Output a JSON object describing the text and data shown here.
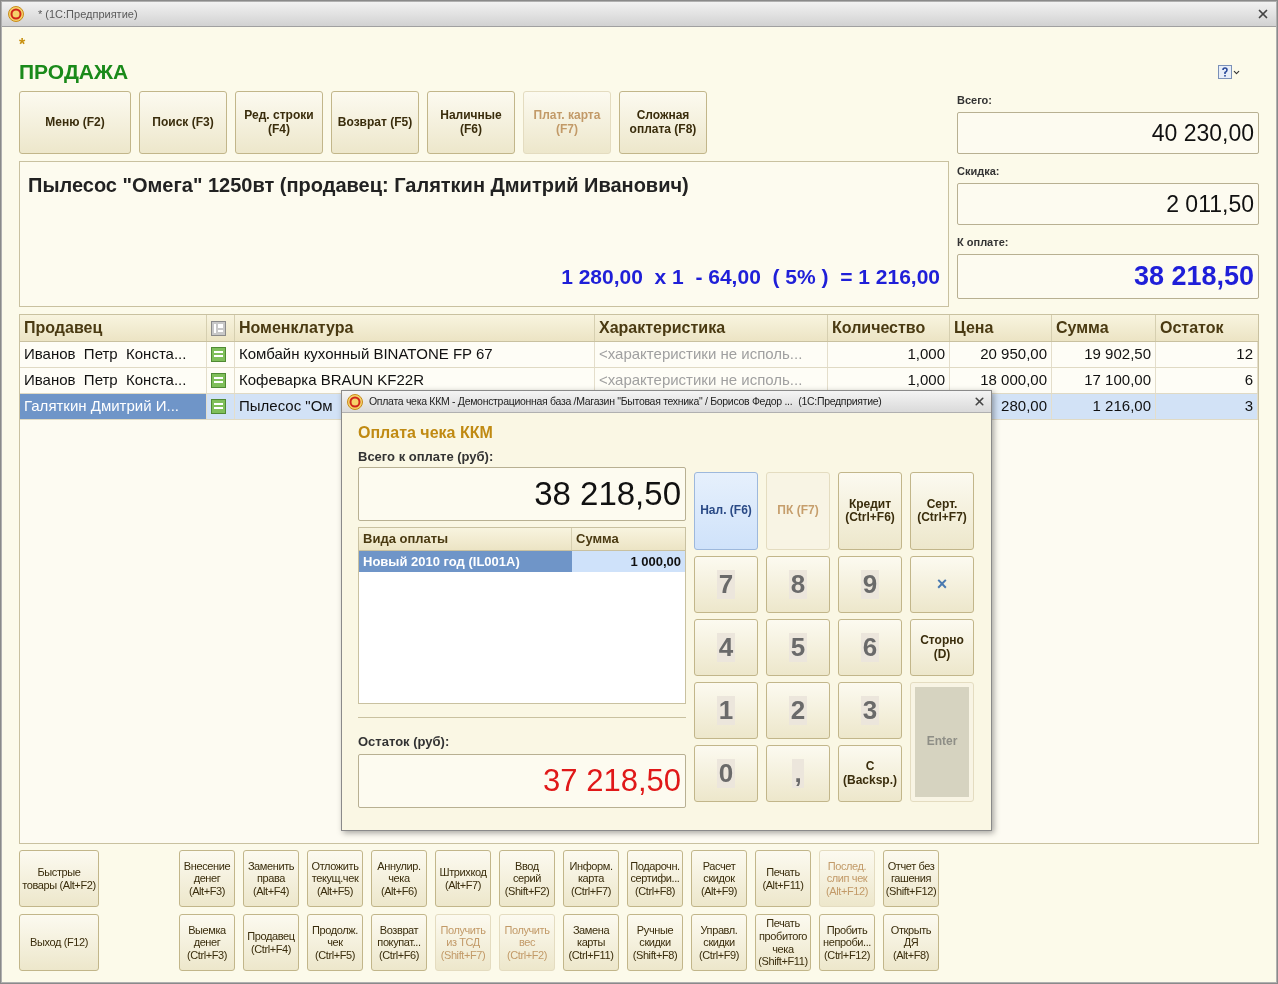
{
  "window": {
    "title": "* (1С:Предприятие)"
  },
  "modified_mark": "*",
  "page_title": "ПРОДАЖА",
  "toolbar": [
    {
      "label": "Меню (F2)",
      "disabled": false
    },
    {
      "label": "Поиск (F3)",
      "disabled": false
    },
    {
      "label": "Ред. строки\n(F4)",
      "disabled": false
    },
    {
      "label": "Возврат (F5)",
      "disabled": false
    },
    {
      "label": "Наличные\n(F6)",
      "disabled": false
    },
    {
      "label": "Плат. карта\n(F7)",
      "disabled": true
    },
    {
      "label": "Сложная\nоплата (F8)",
      "disabled": false
    }
  ],
  "item_info": {
    "title": "Пылесос \"Омега\" 1250вт (продавец: Галяткин Дмитрий Иванович)",
    "calculation": "1 280,00  x 1  - 64,00  ( 5% )  = 1 216,00"
  },
  "totals": [
    {
      "label": "Всего:",
      "value": "40 230,00",
      "kind": "normal"
    },
    {
      "label": "Скидка:",
      "value": "2 011,50",
      "kind": "normal"
    },
    {
      "label": "К оплате:",
      "value": "38 218,50",
      "kind": "due"
    }
  ],
  "table": {
    "columns": [
      {
        "kind": "text",
        "label": "Продавец"
      },
      {
        "kind": "icon"
      },
      {
        "kind": "text",
        "label": "Номенклатура"
      },
      {
        "kind": "text",
        "label": "Характеристика"
      },
      {
        "kind": "text",
        "label": "Количество"
      },
      {
        "kind": "text",
        "label": "Цена"
      },
      {
        "kind": "text",
        "label": "Сумма"
      },
      {
        "kind": "text",
        "label": "Остаток"
      }
    ],
    "rows": [
      {
        "seller": "Иванов  Петр  Конста...",
        "item": "Комбайн кухонный BINATONE FP 67",
        "characteristic": "<характеристики не исполь...",
        "quantity": "1,000",
        "price": "20 950,00",
        "sum": "19 902,50",
        "remainder": "12",
        "selected": false
      },
      {
        "seller": "Иванов  Петр  Конста...",
        "item": "Кофеварка BRAUN KF22R",
        "characteristic": "<характеристики не исполь...",
        "quantity": "1,000",
        "price": "18 000,00",
        "sum": "17 100,00",
        "remainder": "6",
        "selected": false
      },
      {
        "seller": "Галяткин Дмитрий И...",
        "item": "Пылесос \"Ом",
        "price": "280,00",
        "sum": "1 216,00",
        "remainder": "3",
        "selected": true
      }
    ]
  },
  "dialog": {
    "title": "Оплата чека ККМ - Демонстрационная база /Магазин \"Бытовая техника\" / Борисов Федор ...",
    "app_name": "(1С:Предприятие)",
    "heading": "Оплата чека ККМ",
    "total_label": "Всего к оплате (руб):",
    "total": "38 218,50",
    "payments": {
      "columns": [
        "Вида оплаты",
        "Сумма"
      ],
      "rows": [
        {
          "type": "Новый 2010 год (IL001A)",
          "sum": "1 000,00",
          "selected": true
        }
      ]
    },
    "remainder_label": "Остаток (руб):",
    "remainder": "37 218,50",
    "keys": [
      {
        "kind": "action",
        "label": "Нал. (F6)",
        "selected": true,
        "disabled": false
      },
      {
        "kind": "action",
        "label": "ПК (F7)",
        "selected": false,
        "disabled": true
      },
      {
        "kind": "action",
        "label": "Кредит\n(Ctrl+F6)",
        "selected": false,
        "disabled": false
      },
      {
        "kind": "action",
        "label": "Серт.\n(Ctrl+F7)",
        "selected": false,
        "disabled": false
      },
      {
        "kind": "digit",
        "label": "7",
        "selected": false,
        "disabled": false
      },
      {
        "kind": "digit",
        "label": "8",
        "selected": false,
        "disabled": false
      },
      {
        "kind": "digit",
        "label": "9",
        "selected": false,
        "disabled": false
      },
      {
        "kind": "symbol",
        "label": "×",
        "selected": false,
        "disabled": false
      },
      {
        "kind": "digit",
        "label": "4",
        "selected": false,
        "disabled": false
      },
      {
        "kind": "digit",
        "label": "5",
        "selected": false,
        "disabled": false
      },
      {
        "kind": "digit",
        "label": "6",
        "selected": false,
        "disabled": false
      },
      {
        "kind": "action",
        "label": "Сторно\n(D)",
        "selected": false,
        "disabled": false
      },
      {
        "kind": "digit",
        "label": "1",
        "selected": false,
        "disabled": false
      },
      {
        "kind": "digit",
        "label": "2",
        "selected": false,
        "disabled": false
      },
      {
        "kind": "digit",
        "label": "3",
        "selected": false,
        "disabled": false
      },
      {
        "kind": "enter",
        "label": "Enter",
        "selected": false,
        "disabled": true
      },
      {
        "kind": "digit",
        "label": "0",
        "selected": false,
        "disabled": false
      },
      {
        "kind": "digit",
        "label": ",",
        "selected": false,
        "disabled": false
      },
      {
        "kind": "action",
        "label": "C\n(Backsp.)",
        "selected": false,
        "disabled": false
      }
    ]
  },
  "bottom_buttons": [
    [
      {
        "label": "Быстрые\nтовары (Alt+F2)",
        "disabled": false
      },
      {
        "label": "Внесение\nденег\n(Alt+F3)",
        "disabled": false
      },
      {
        "label": "Заменить\nправа\n(Alt+F4)",
        "disabled": false
      },
      {
        "label": "Отложить\nтекущ.чек\n(Alt+F5)",
        "disabled": false
      },
      {
        "label": "Аннулир.\nчека\n(Alt+F6)",
        "disabled": false
      },
      {
        "label": "Штрихкод\n(Alt+F7)",
        "disabled": false
      },
      {
        "label": "Ввод\nсерий\n(Shift+F2)",
        "disabled": false
      },
      {
        "label": "Информ.\nкарта\n(Ctrl+F7)",
        "disabled": false
      },
      {
        "label": "Подарочн.\nсертифи...\n(Ctrl+F8)",
        "disabled": false
      },
      {
        "label": "Расчет\nскидок\n(Alt+F9)",
        "disabled": false
      },
      {
        "label": "Печать\n(Alt+F11)",
        "disabled": false
      },
      {
        "label": "Послед.\nслип чек\n(Alt+F12)",
        "disabled": true
      },
      {
        "label": "Отчет без\nгашения\n(Shift+F12)",
        "disabled": false
      }
    ],
    [
      {
        "label": "Выход (F12)",
        "disabled": false
      },
      {
        "label": "Выемка\nденег\n(Ctrl+F3)",
        "disabled": false
      },
      {
        "label": "Продавец\n(Ctrl+F4)",
        "disabled": false
      },
      {
        "label": "Продолж.\nчек\n(Ctrl+F5)",
        "disabled": false
      },
      {
        "label": "Возврат\nпокупат...\n(Ctrl+F6)",
        "disabled": false
      },
      {
        "label": "Получить\nиз ТСД\n(Shift+F7)",
        "disabled": true
      },
      {
        "label": "Получить\nвес\n(Ctrl+F2)",
        "disabled": true
      },
      {
        "label": "Замена\nкарты\n(Ctrl+F11)",
        "disabled": false
      },
      {
        "label": "Ручные\nскидки\n(Shift+F8)",
        "disabled": false
      },
      {
        "label": "Управл.\nскидки\n(Ctrl+F9)",
        "disabled": false
      },
      {
        "label": "Печать\nпробитого\nчека\n(Shift+F11)",
        "disabled": false
      },
      {
        "label": "Пробить\nнепроби...\n(Ctrl+F12)",
        "disabled": false
      },
      {
        "label": "Открыть\nДЯ\n(Alt+F8)",
        "disabled": false
      }
    ]
  ]
}
